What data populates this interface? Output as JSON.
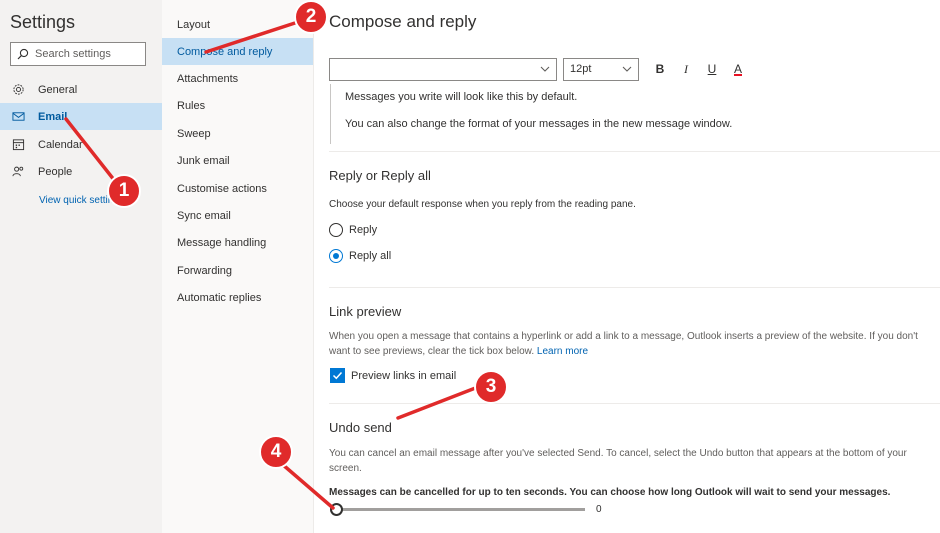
{
  "sidebar": {
    "title": "Settings",
    "search_placeholder": "Search settings",
    "items": [
      {
        "label": "General",
        "icon": "gear-icon"
      },
      {
        "label": "Email",
        "icon": "mail-icon",
        "active": true
      },
      {
        "label": "Calendar",
        "icon": "calendar-icon"
      },
      {
        "label": "People",
        "icon": "people-icon"
      }
    ],
    "quick_settings_link": "View quick settings"
  },
  "submenu": {
    "items": [
      {
        "label": "Layout"
      },
      {
        "label": "Compose and reply",
        "active": true
      },
      {
        "label": "Attachments"
      },
      {
        "label": "Rules"
      },
      {
        "label": "Sweep"
      },
      {
        "label": "Junk email"
      },
      {
        "label": "Customise actions"
      },
      {
        "label": "Sync email"
      },
      {
        "label": "Message handling"
      },
      {
        "label": "Forwarding"
      },
      {
        "label": "Automatic replies"
      }
    ]
  },
  "main": {
    "title": "Compose and reply",
    "format": {
      "font_value": "",
      "size_value": "12pt",
      "bold": "B",
      "italic": "I",
      "underline": "U",
      "font_color": "A"
    },
    "preview_line_1": "Messages you write will look like this by default.",
    "preview_line_2": "You can also change the format of your messages in the new message window.",
    "reply": {
      "heading": "Reply or Reply all",
      "description": "Choose your default response when you reply from the reading pane.",
      "options": [
        {
          "label": "Reply",
          "selected": false
        },
        {
          "label": "Reply all",
          "selected": true
        }
      ]
    },
    "link_preview": {
      "heading": "Link preview",
      "description": "When you open a message that contains a hyperlink or add a link to a message, Outlook inserts a preview of the website. If you don't want to see previews, clear the tick box below.",
      "learn_more": "Learn more",
      "checkbox_label": "Preview links in email",
      "checked": true
    },
    "undo_send": {
      "heading": "Undo send",
      "description": "You can cancel an email message after you've selected Send. To cancel, select the Undo button that appears at the bottom of your screen.",
      "instruction": "Messages can be cancelled for up to ten seconds. You can choose how long Outlook will wait to send your messages.",
      "slider_value": "0"
    }
  },
  "annotations": {
    "badges": [
      "1",
      "2",
      "3",
      "4"
    ],
    "color": "#e02a2a"
  },
  "colors": {
    "accent": "#0078d4",
    "active_bg": "#c7e0f4",
    "link": "#0063b1"
  }
}
